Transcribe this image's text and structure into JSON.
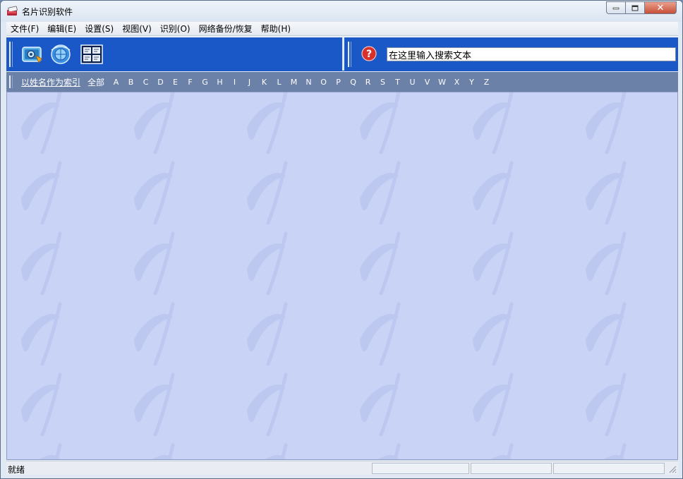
{
  "window": {
    "title": "名片识别软件",
    "icon": "business-card-app-icon"
  },
  "menu": {
    "items": [
      {
        "label": "文件(F)"
      },
      {
        "label": "编辑(E)"
      },
      {
        "label": "设置(S)"
      },
      {
        "label": "视图(V)"
      },
      {
        "label": "识别(O)"
      },
      {
        "label": "网络备份/恢复"
      },
      {
        "label": "帮助(H)"
      }
    ]
  },
  "toolbar": {
    "buttons": [
      {
        "icon": "scan-card-icon"
      },
      {
        "icon": "recognize-globe-icon"
      },
      {
        "icon": "card-grid-view-icon"
      }
    ],
    "help_icon": "help-icon",
    "search_value": "在这里输入搜索文本"
  },
  "index_bar": {
    "link_label": "以姓名作为索引",
    "all_label": "全部",
    "letters": [
      "A",
      "B",
      "C",
      "D",
      "E",
      "F",
      "G",
      "H",
      "I",
      "J",
      "K",
      "L",
      "M",
      "N",
      "O",
      "P",
      "Q",
      "R",
      "S",
      "T",
      "U",
      "V",
      "W",
      "X",
      "Y",
      "Z"
    ]
  },
  "status": {
    "text": "就绪"
  },
  "colors": {
    "toolbar_bg": "#1a58c7",
    "index_bar_bg": "#6b81a8",
    "content_bg": "#c9d3f5"
  }
}
